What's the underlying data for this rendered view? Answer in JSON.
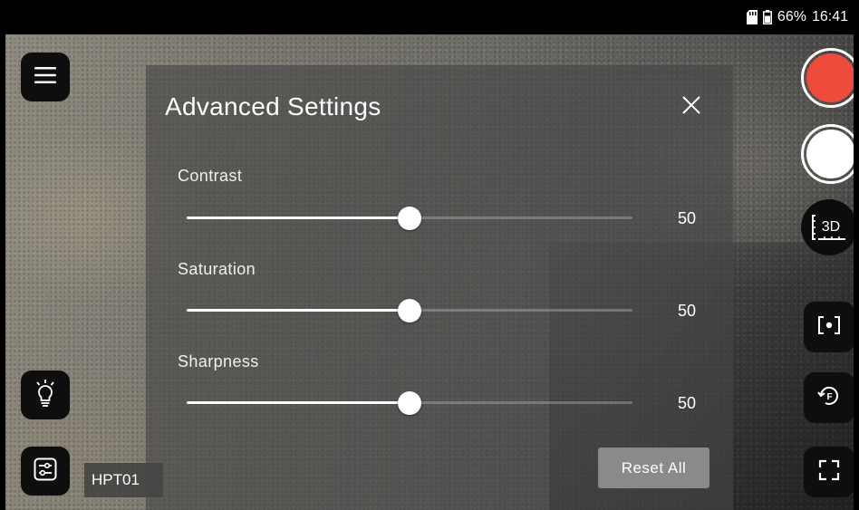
{
  "status_bar": {
    "battery": "66%",
    "time": "16:41",
    "icons": [
      "sd-card-icon",
      "battery-icon"
    ]
  },
  "left_controls": {
    "menu_icon": "hamburger-menu-icon",
    "light_icon": "lightbulb-icon",
    "settings_icon": "sliders-settings-icon"
  },
  "device_tag": "HPT01",
  "panel": {
    "title": "Advanced Settings",
    "close_icon": "close-icon",
    "settings": [
      {
        "label": "Contrast",
        "value": "50",
        "level": 0.5
      },
      {
        "label": "Saturation",
        "value": "50",
        "level": 0.5
      },
      {
        "label": "Sharpness",
        "value": "50",
        "level": 0.5
      }
    ],
    "reset_label": "Reset All"
  },
  "right_controls": {
    "record_icon": "record-icon",
    "capture_icon": "capture-icon",
    "measure_label": "3D",
    "focus_icon": "focus-target-icon",
    "rotate_icon": "rotate-f-icon",
    "fullscreen_icon": "fullscreen-icon"
  },
  "colors": {
    "record_red": "#ef4b3c",
    "panel_bg": "rgba(70,70,70,0.62)",
    "button_bg": "#0e0e0e"
  }
}
